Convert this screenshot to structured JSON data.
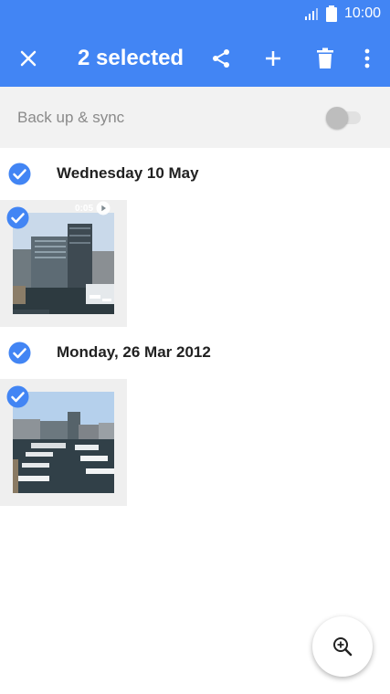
{
  "status_bar": {
    "time": "10:00",
    "icons": [
      "signal-icon",
      "battery-icon"
    ]
  },
  "toolbar": {
    "title": "2 selected",
    "actions": [
      "close-icon",
      "share-icon",
      "add-icon",
      "delete-icon",
      "more-vert-icon"
    ]
  },
  "sync": {
    "label": "Back up & sync",
    "enabled": false
  },
  "groups": [
    {
      "date": "Wednesday 10 May",
      "selected": true,
      "items": [
        {
          "type": "video",
          "duration": "0:05",
          "selected": true
        }
      ]
    },
    {
      "date": "Monday, 26 Mar 2012",
      "selected": true,
      "items": [
        {
          "type": "photo",
          "selected": true
        }
      ]
    }
  ],
  "fab": {
    "icon": "zoom-in-icon"
  },
  "colors": {
    "accent": "#4285f4",
    "check": "#4285f4"
  }
}
